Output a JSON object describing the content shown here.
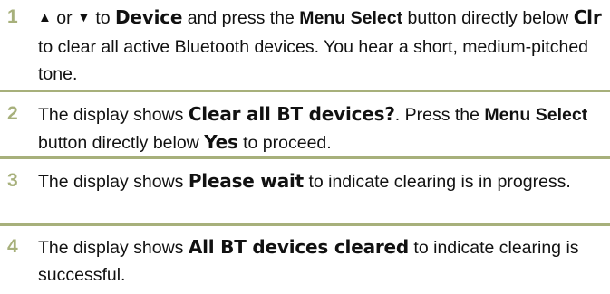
{
  "steps": [
    {
      "number": "1",
      "up_glyph": "▲",
      "t1": " or ",
      "down_glyph": "▼",
      "t2": " to ",
      "d1": "Device",
      "t3": " and press the ",
      "b1": "Menu Select",
      "t4": " button directly below ",
      "d2": "Clr",
      "t5": " to clear all active Bluetooth devices. You hear a short, medium-pitched tone."
    },
    {
      "number": "2",
      "t1": "The display shows ",
      "d1": "Clear all BT devices?",
      "t2": ". Press the ",
      "b1": "Menu Select",
      "t3": " button directly below ",
      "d2": "Yes",
      "t4": " to proceed."
    },
    {
      "number": "3",
      "t1": "The display shows ",
      "d1": "Please wait",
      "t2": " to indicate clearing is in progress."
    },
    {
      "number": "4",
      "t1": "The display shows ",
      "d1": "All BT devices cleared",
      "t2": " to indicate clearing is successful."
    }
  ],
  "colors": {
    "accent": "#a7b07b",
    "text": "#111111"
  }
}
